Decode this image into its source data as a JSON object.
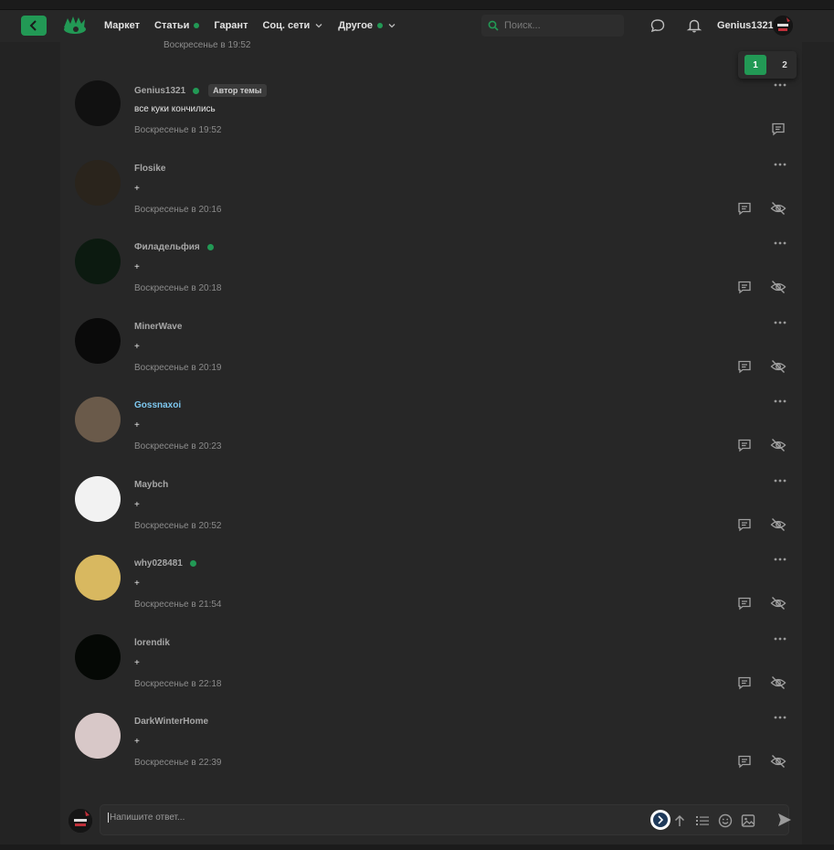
{
  "header": {
    "nav": [
      {
        "label": "Маркет",
        "dot": false,
        "chevron": false
      },
      {
        "label": "Статьи",
        "dot": true,
        "chevron": false
      },
      {
        "label": "Гарант",
        "dot": false,
        "chevron": false
      },
      {
        "label": "Соц. сети",
        "dot": false,
        "chevron": true
      },
      {
        "label": "Другое",
        "dot": true,
        "chevron": true
      }
    ],
    "search_placeholder": "Поиск...",
    "username": "Genius1321"
  },
  "thread": {
    "prev_time": "Воскресенье в 19:52",
    "pages": [
      "1",
      "2"
    ],
    "current_page": "1",
    "author_badge": "Автор темы",
    "posts": [
      {
        "name": "Genius1321",
        "online": true,
        "author": true,
        "text": "все куки кончились",
        "time": "Воскресенье в 19:52",
        "avatar_color": "#111111",
        "name_color": "#a7a7a7"
      },
      {
        "name": "Flosike",
        "online": false,
        "author": false,
        "text": "+",
        "time": "Воскресенье в 20:16",
        "avatar_color": "#2a241c",
        "name_color": "#a7a7a7"
      },
      {
        "name": "Филадельфия",
        "online": true,
        "author": false,
        "text": "+",
        "time": "Воскресенье в 20:18",
        "avatar_color": "#0c1a10",
        "name_color": "#a7a7a7"
      },
      {
        "name": "MinerWave",
        "online": false,
        "author": false,
        "text": "+",
        "time": "Воскресенье в 20:19",
        "avatar_color": "#0a0a0a",
        "name_color": "#a7a7a7"
      },
      {
        "name": "Gossnaxoi",
        "online": false,
        "author": false,
        "text": "+",
        "time": "Воскресенье в 20:23",
        "avatar_color": "#6a5a4a",
        "name_color": "#7ec8f0"
      },
      {
        "name": "Maybch",
        "online": false,
        "author": false,
        "text": "+",
        "time": "Воскресенье в 20:52",
        "avatar_color": "#f2f2f2",
        "name_color": "#a7a7a7"
      },
      {
        "name": "why028481",
        "online": true,
        "author": false,
        "text": "+",
        "time": "Воскресенье в 21:54",
        "avatar_color": "#d8b860",
        "name_color": "#a7a7a7"
      },
      {
        "name": "lorendik",
        "online": false,
        "author": false,
        "text": "+",
        "time": "Воскресенье в 22:18",
        "avatar_color": "#050805",
        "name_color": "#a7a7a7"
      },
      {
        "name": "DarkWinterHome",
        "online": false,
        "author": false,
        "text": "+",
        "time": "Воскресенье в 22:39",
        "avatar_color": "#d8c8c8",
        "name_color": "#a7a7a7"
      }
    ]
  },
  "composer": {
    "placeholder": "Напишите ответ..."
  },
  "colors": {
    "accent": "#229955",
    "background": "#232323",
    "panel": "#272727"
  }
}
